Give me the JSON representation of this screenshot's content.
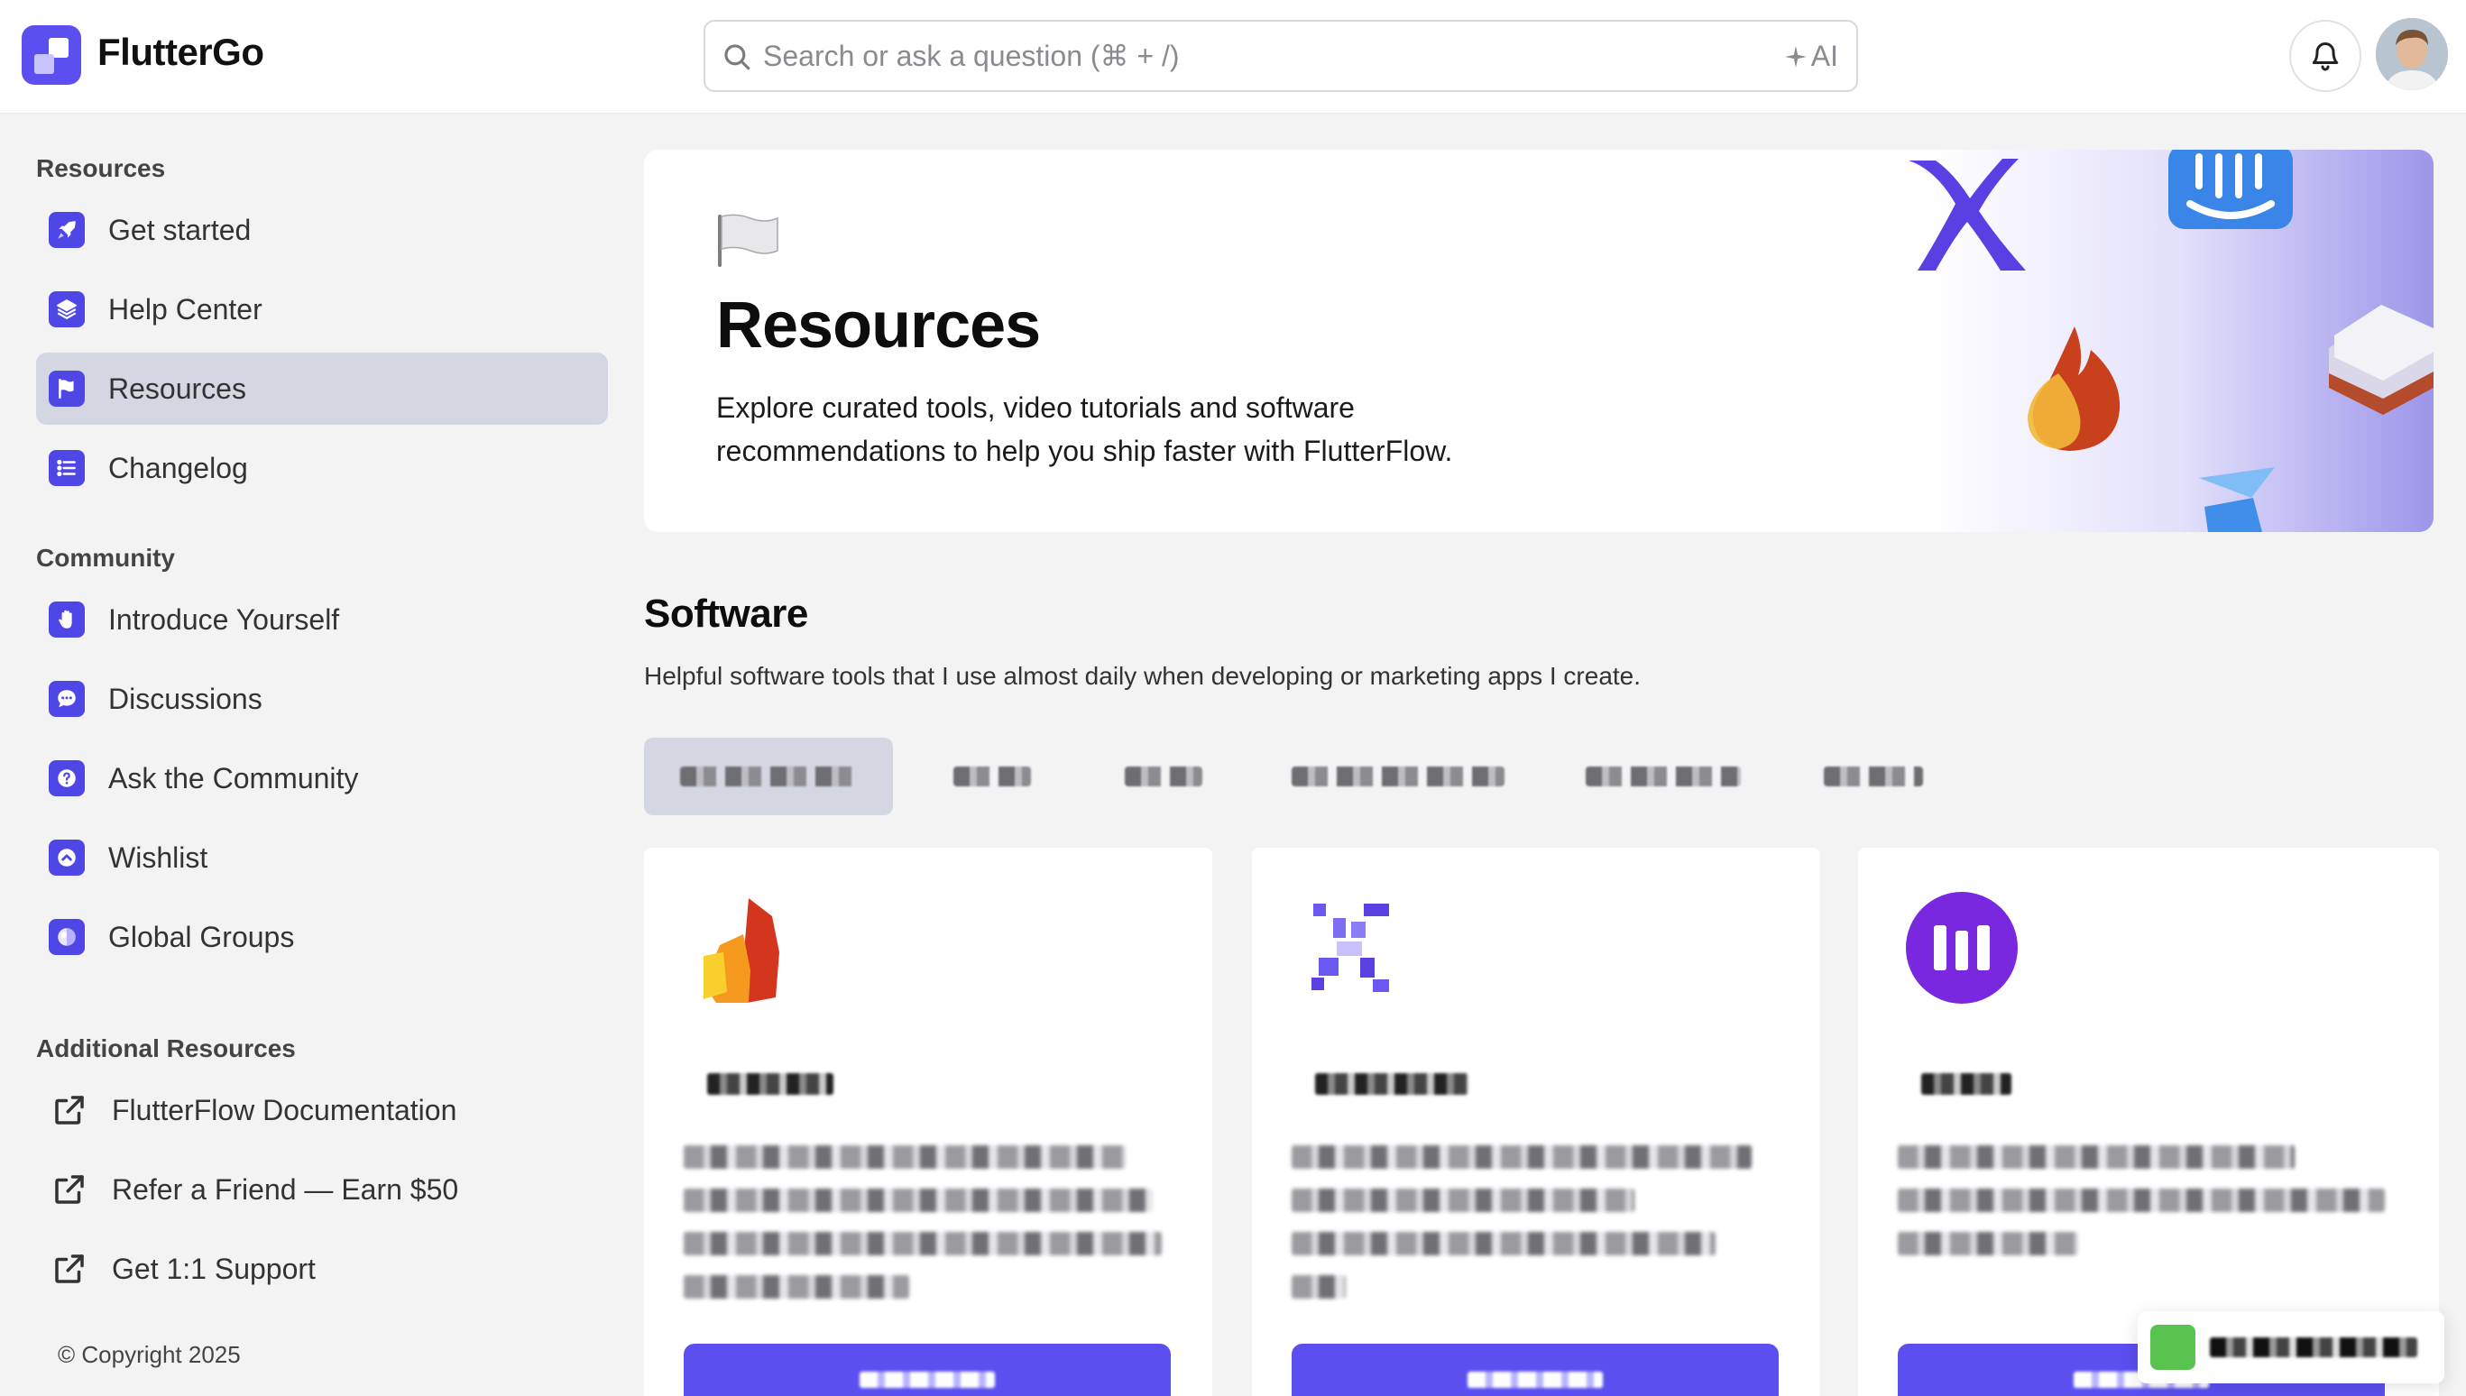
{
  "header": {
    "brand": "FlutterGo",
    "search_placeholder": "Search or ask a question (⌘ + /)",
    "ai_label": "AI"
  },
  "sidebar": {
    "sections": [
      {
        "title": "Resources",
        "items": [
          {
            "label": "Get started",
            "icon": "rocket-icon"
          },
          {
            "label": "Help Center",
            "icon": "layers-icon"
          },
          {
            "label": "Resources",
            "icon": "flag-icon",
            "active": true
          },
          {
            "label": "Changelog",
            "icon": "list-icon"
          }
        ]
      },
      {
        "title": "Community",
        "items": [
          {
            "label": "Introduce Yourself",
            "icon": "wave-hand-icon"
          },
          {
            "label": "Discussions",
            "icon": "chat-bubble-icon"
          },
          {
            "label": "Ask the Community",
            "icon": "question-icon"
          },
          {
            "label": "Wishlist",
            "icon": "chevron-up-circle-icon"
          },
          {
            "label": "Global Groups",
            "icon": "globe-icon"
          }
        ]
      },
      {
        "title": "Additional Resources",
        "items": [
          {
            "label": "FlutterFlow Documentation",
            "icon": "external-link-icon"
          },
          {
            "label": "Refer a Friend — Earn $50",
            "icon": "external-link-icon"
          },
          {
            "label": "Get 1:1 Support",
            "icon": "external-link-icon"
          }
        ]
      }
    ],
    "copyright": "© Copyright 2025"
  },
  "hero": {
    "title": "Resources",
    "description_line1": "Explore curated tools, video tutorials and software",
    "description_line2": "recommendations to help you ship faster with FlutterFlow."
  },
  "software": {
    "title": "Software",
    "description": "Helpful software tools that I use almost daily when developing or marketing apps I create."
  },
  "colors": {
    "accent": "#5b4ff0",
    "active_bg": "#d4d6e2",
    "page_bg": "#f3f3f4"
  }
}
